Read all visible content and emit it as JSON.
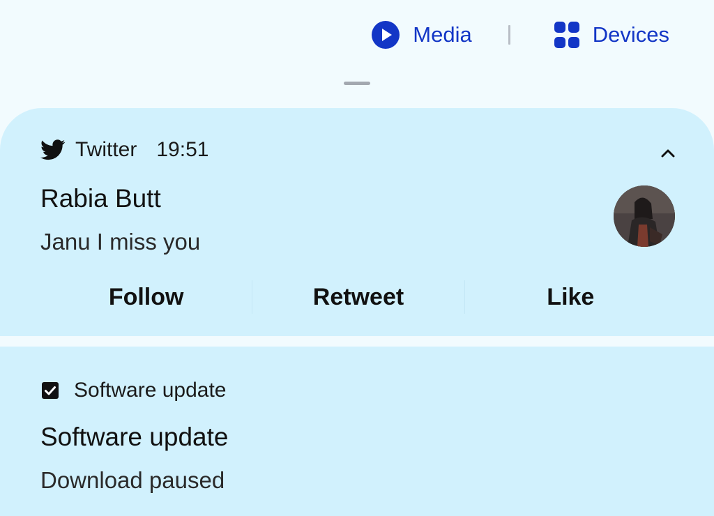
{
  "quick_buttons": {
    "media_label": "Media",
    "devices_label": "Devices",
    "media_icon": "play-circle-icon",
    "devices_icon": "devices-grid-icon"
  },
  "twitter_notification": {
    "app_name": "Twitter",
    "time": "19:51",
    "title": "Rabia Butt",
    "text": "Janu I miss you",
    "actions": [
      "Follow",
      "Retweet",
      "Like"
    ],
    "icon": "twitter-bird-icon"
  },
  "update_notification": {
    "app_name": "Software update",
    "title": "Software update",
    "text": "Download paused",
    "icon": "checkbox-icon"
  },
  "colors": {
    "accent": "#1336c6",
    "card_background": "#d1f1fd",
    "page_background": "#f2fbfe"
  }
}
